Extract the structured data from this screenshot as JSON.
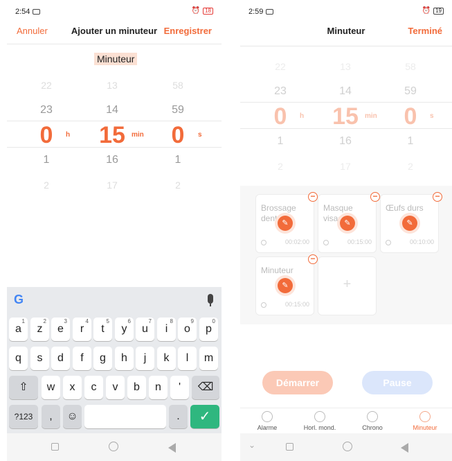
{
  "left": {
    "status": {
      "time": "2:54",
      "battery": "18"
    },
    "header": {
      "cancel": "Annuler",
      "title": "Ajouter un minuteur",
      "save": "Enregistrer"
    },
    "name_value": "Minuteur",
    "picker": {
      "hours": [
        "22",
        "23",
        "0",
        "1",
        "2"
      ],
      "minutes": [
        "13",
        "14",
        "15",
        "16",
        "17"
      ],
      "seconds": [
        "58",
        "59",
        "0",
        "1",
        "2"
      ],
      "units": {
        "h": "h",
        "min": "min",
        "s": "s"
      }
    },
    "keyboard": {
      "logo": "G",
      "row1": [
        {
          "k": "a",
          "s": "1"
        },
        {
          "k": "z",
          "s": "2"
        },
        {
          "k": "e",
          "s": "3"
        },
        {
          "k": "r",
          "s": "4"
        },
        {
          "k": "t",
          "s": "5"
        },
        {
          "k": "y",
          "s": "6"
        },
        {
          "k": "u",
          "s": "7"
        },
        {
          "k": "i",
          "s": "8"
        },
        {
          "k": "o",
          "s": "9"
        },
        {
          "k": "p",
          "s": "0"
        }
      ],
      "row2": [
        "q",
        "s",
        "d",
        "f",
        "g",
        "h",
        "j",
        "k",
        "l",
        "m"
      ],
      "row3": [
        "⇧",
        "w",
        "x",
        "c",
        "v",
        "b",
        "n",
        "'",
        "⌫"
      ],
      "row4": {
        "symbols": "?123",
        "comma": ",",
        "emoji": "☺",
        "period": ".",
        "enter": "✓"
      }
    }
  },
  "right": {
    "status": {
      "time": "2:59",
      "battery": "19"
    },
    "header": {
      "title": "Minuteur",
      "done": "Terminé"
    },
    "picker": {
      "hours": [
        "22",
        "23",
        "0",
        "1",
        "2"
      ],
      "minutes": [
        "13",
        "14",
        "15",
        "16",
        "17"
      ],
      "seconds": [
        "58",
        "59",
        "0",
        "1",
        "2"
      ],
      "units": {
        "h": "h",
        "min": "min",
        "s": "s"
      }
    },
    "presets": [
      {
        "name": "Brossage dents",
        "time": "00:02:00"
      },
      {
        "name": "Masque visage",
        "time": "00:15:00"
      },
      {
        "name": "Œufs durs",
        "time": "00:10:00"
      },
      {
        "name": "Minuteur",
        "time": "00:15:00"
      }
    ],
    "add_label": "+",
    "buttons": {
      "start": "Démarrer",
      "pause": "Pause"
    },
    "tabs": [
      {
        "label": "Alarme",
        "icon": "alarm-clock-icon"
      },
      {
        "label": "Horl. mond.",
        "icon": "globe-icon"
      },
      {
        "label": "Chrono",
        "icon": "stopwatch-icon"
      },
      {
        "label": "Minuteur",
        "icon": "timer-icon"
      }
    ],
    "active_tab": "Minuteur"
  },
  "colors": {
    "accent": "#f26b3a",
    "enter_key": "#2fb77f",
    "pause": "#dbe6fb"
  }
}
